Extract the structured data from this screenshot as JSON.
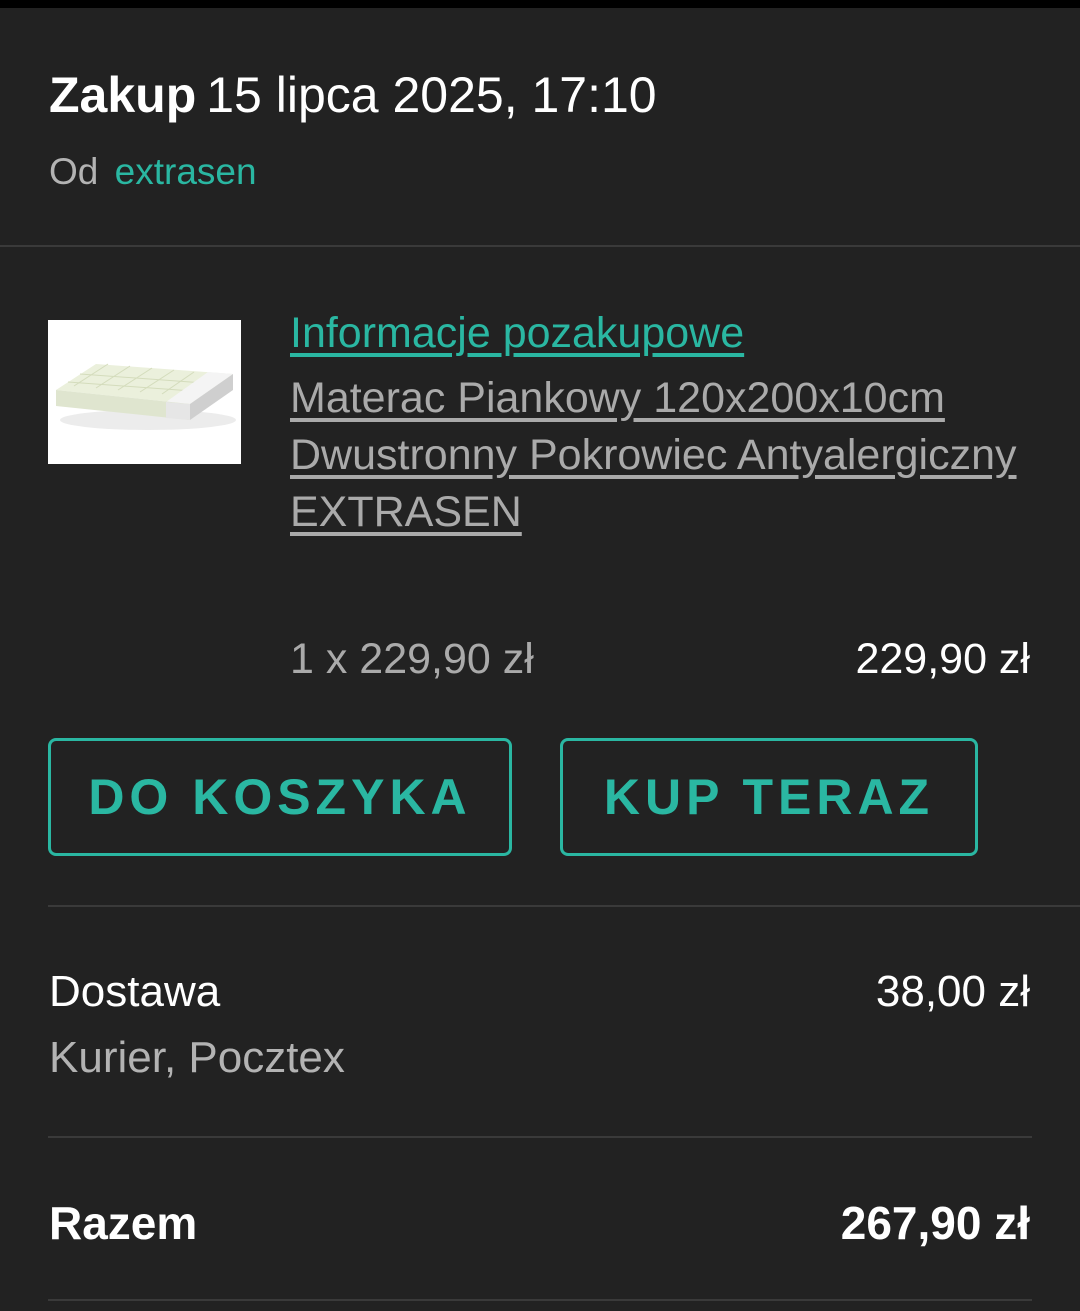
{
  "header": {
    "title": "Zakup",
    "date": "15 lipca 2025, 17:10",
    "seller_prefix": "Od",
    "seller_name": "extrasen"
  },
  "product": {
    "info_link": "Informacje pozakupowe",
    "name": "Materac Piankowy 120x200x10cm Dwustronny Pokrowiec Antyalergiczny EXTRASEN",
    "quantity_price": "1 x 229,90 zł",
    "line_total": "229,90 zł",
    "image_icon": "mattress-image"
  },
  "actions": {
    "add_to_cart": "DO KOSZYKA",
    "buy_now": "KUP TERAZ"
  },
  "shipping": {
    "label": "Dostawa",
    "method": "Kurier, Pocztex",
    "cost": "38,00 zł"
  },
  "summary": {
    "label": "Razem",
    "total": "267,90 zł"
  },
  "colors": {
    "background": "#222222",
    "accent": "#2ab7a2",
    "muted_text": "#aaaaaa",
    "divider": "#3a3a3a"
  }
}
